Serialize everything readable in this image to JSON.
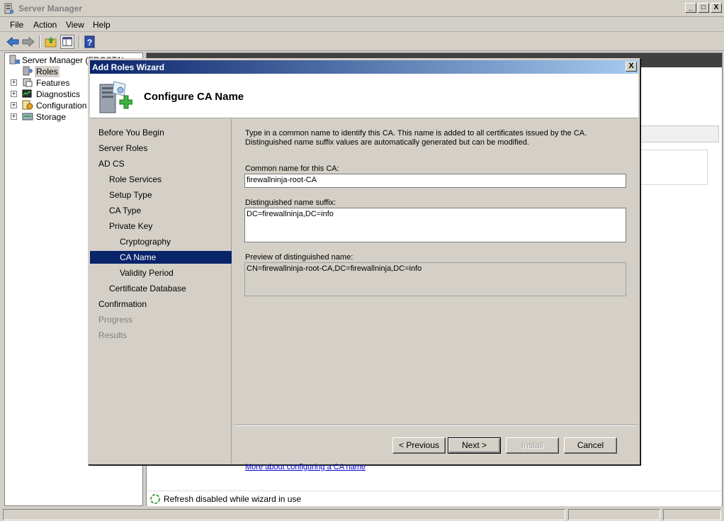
{
  "window": {
    "title": "Server Manager",
    "buttons": [
      "_",
      "□",
      "X"
    ]
  },
  "menu": [
    "File",
    "Action",
    "View",
    "Help"
  ],
  "tree": {
    "root": "Server Manager (FROST1)",
    "items": [
      {
        "label": "Roles",
        "icon": "roles-icon",
        "expandable": false,
        "selected": true
      },
      {
        "label": "Features",
        "icon": "features-icon",
        "expandable": true
      },
      {
        "label": "Diagnostics",
        "icon": "diagnostics-icon",
        "expandable": true
      },
      {
        "label": "Configuration",
        "icon": "configuration-icon",
        "expandable": true
      },
      {
        "label": "Storage",
        "icon": "storage-icon",
        "expandable": true
      }
    ]
  },
  "status_line": "Refresh disabled while wizard in use",
  "wizard": {
    "title": "Add Roles Wizard",
    "close": "X",
    "heading": "Configure CA Name",
    "nav": [
      {
        "label": "Before You Begin",
        "level": 0,
        "state": "normal"
      },
      {
        "label": "Server Roles",
        "level": 0,
        "state": "normal"
      },
      {
        "label": "AD CS",
        "level": 0,
        "state": "normal"
      },
      {
        "label": "Role Services",
        "level": 1,
        "state": "normal"
      },
      {
        "label": "Setup Type",
        "level": 1,
        "state": "normal"
      },
      {
        "label": "CA Type",
        "level": 1,
        "state": "normal"
      },
      {
        "label": "Private Key",
        "level": 1,
        "state": "normal"
      },
      {
        "label": "Cryptography",
        "level": 2,
        "state": "normal"
      },
      {
        "label": "CA Name",
        "level": 2,
        "state": "active"
      },
      {
        "label": "Validity Period",
        "level": 2,
        "state": "normal"
      },
      {
        "label": "Certificate Database",
        "level": 1,
        "state": "normal"
      },
      {
        "label": "Confirmation",
        "level": 0,
        "state": "normal"
      },
      {
        "label": "Progress",
        "level": 0,
        "state": "disabled"
      },
      {
        "label": "Results",
        "level": 0,
        "state": "disabled"
      }
    ],
    "description_line1": "Type in a common name to identify this CA. This name is added to all certificates issued by the CA.",
    "description_line2": "Distinguished name suffix values are automatically generated but can be modified.",
    "common_name_label": "Common name for this CA:",
    "common_name_value": "firewallninja-root-CA",
    "dn_suffix_label": "Distinguished name suffix:",
    "dn_suffix_value": "DC=firewallninja,DC=info",
    "preview_label": "Preview of distinguished name:",
    "preview_value": "CN=firewallninja-root-CA,DC=firewallninja,DC=info",
    "link": "More about configuring a CA name",
    "buttons": {
      "previous": "< Previous",
      "next": "Next >",
      "install": "Install",
      "cancel": "Cancel"
    }
  }
}
